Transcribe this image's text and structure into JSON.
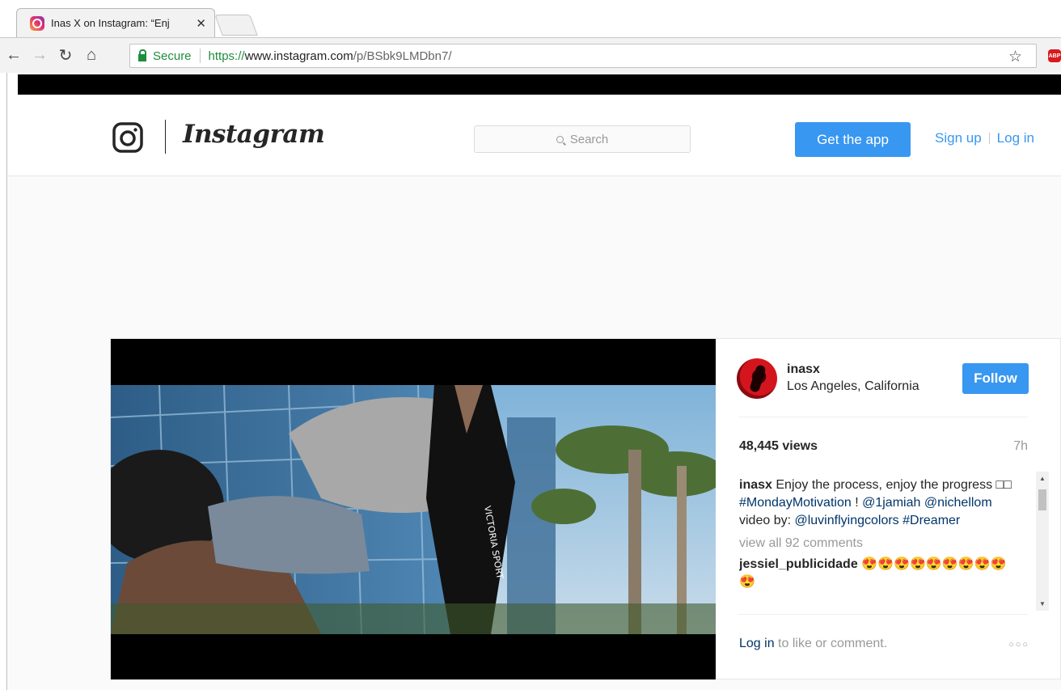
{
  "browser": {
    "tab_title": "Inas X on Instagram: “Enj",
    "tab_close": "✕",
    "secure_label": "Secure",
    "url_scheme": "https://",
    "url_host": "www.instagram.com",
    "url_path": "/p/BSbk9LMDbn7/",
    "extension_label": "ABP"
  },
  "header": {
    "brand": "Instagram",
    "search_placeholder": "Search",
    "get_app": "Get the app",
    "sign_up": "Sign up",
    "log_in": "Log in"
  },
  "post": {
    "username": "inasx",
    "location": "Los Angeles, California",
    "follow": "Follow",
    "views": "48,445 views",
    "time_ago": "7h",
    "caption_user": "inasx",
    "caption_text": " Enjoy the process, enjoy the progress □□ ",
    "caption_tag1": "#MondayMotivation",
    "caption_after_tag1": " ! ",
    "caption_mention1": "@1jamiah",
    "caption_mention2": "@nichellom",
    "caption_mid": " video by: ",
    "caption_mention3": "@luvinflyingcolors",
    "caption_tag2": "#Dreamer",
    "view_all_comments": "view all 92 comments",
    "comment_user": "jessiel_publicidade",
    "comment_text": " 😍😍😍😍😍😍😍😍😍😍",
    "login_link": "Log in",
    "login_rest": " to like or comment.",
    "more": "○○○",
    "video_text": "VICTORIA SPORT"
  },
  "colors": {
    "accent": "#3897f0",
    "secure": "#1e8e3e",
    "link": "#003569"
  }
}
